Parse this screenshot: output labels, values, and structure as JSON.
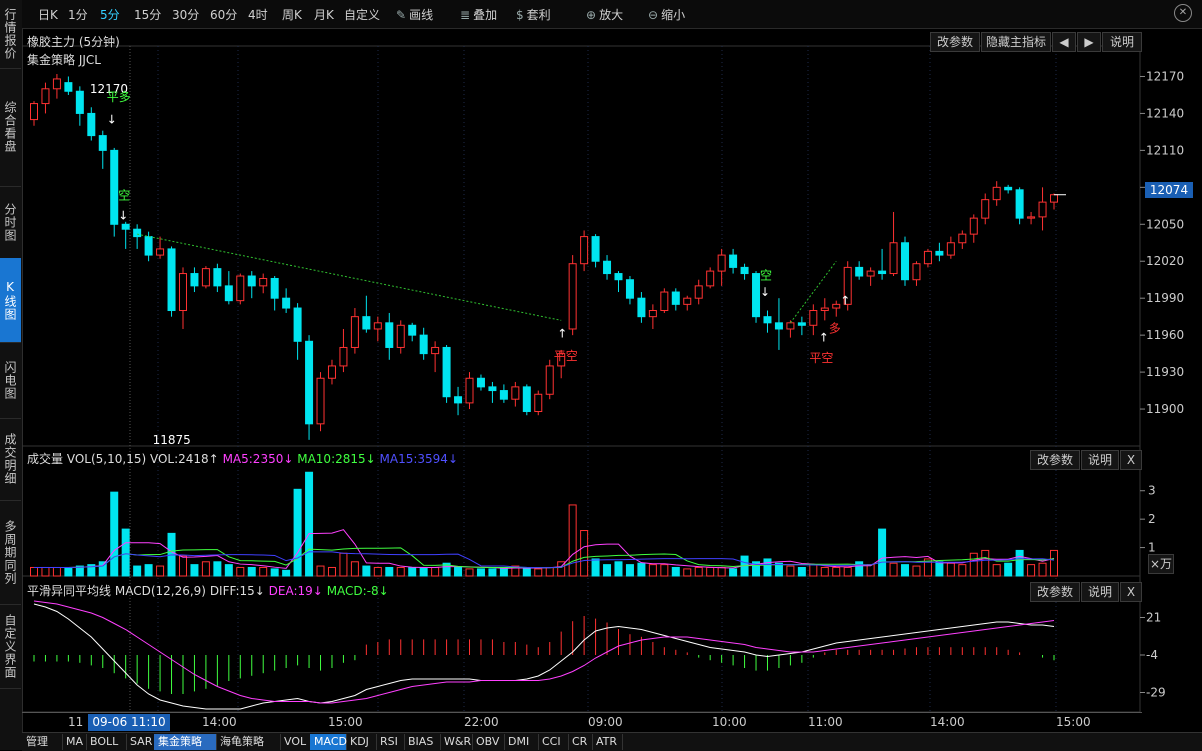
{
  "toolbar": {
    "items": [
      {
        "label": "日K",
        "active": false
      },
      {
        "label": "1分",
        "active": false
      },
      {
        "label": "5分",
        "active": true
      },
      {
        "label": "15分",
        "active": false
      },
      {
        "label": "30分",
        "active": false
      },
      {
        "label": "60分",
        "active": false
      },
      {
        "label": "4时",
        "active": false
      },
      {
        "label": "周K",
        "active": false
      },
      {
        "label": "月K",
        "active": false
      },
      {
        "label": "自定义",
        "active": false
      },
      {
        "label": "画线",
        "icon": "pencil-icon"
      },
      {
        "label": "叠加",
        "icon": "stack-icon"
      },
      {
        "label": "套利",
        "icon": "money-bag-icon"
      },
      {
        "label": "放大",
        "icon": "zoom-in-icon"
      },
      {
        "label": "缩小",
        "icon": "zoom-out-icon"
      }
    ]
  },
  "sidebar": {
    "items": [
      {
        "label": "行情报价",
        "active": false
      },
      {
        "label": "综合看盘",
        "active": false
      },
      {
        "label": "分时图",
        "active": false
      },
      {
        "label": "K线图",
        "active": true
      },
      {
        "label": "闪电图",
        "active": false
      },
      {
        "label": "成交明细",
        "active": false
      },
      {
        "label": "多周期同列",
        "active": false
      },
      {
        "label": "自定义界面",
        "active": false
      }
    ]
  },
  "main_panel": {
    "title": "橡胶主力 (5分钟)",
    "strategy": "集金策略 JJCL",
    "buttons": {
      "params": "改参数",
      "hide": "隐藏主指标",
      "prev": "◀",
      "next": "▶",
      "help": "说明"
    },
    "current_price": "12074"
  },
  "vol_panel": {
    "label": "成交量",
    "name": "VOL(5,10,15)",
    "vol": "VOL:2418↑",
    "ma5": "MA5:2350↓",
    "ma10": "MA10:2815↓",
    "ma15": "MA15:3594↓",
    "unit": "×万",
    "buttons": {
      "params": "改参数",
      "help": "说明",
      "close": "X"
    }
  },
  "macd_panel": {
    "label": "平滑异同平均线",
    "name": "MACD(12,26,9)",
    "diff": "DIFF:15↓",
    "dea": "DEA:19↓",
    "macd": "MACD:-8↓",
    "buttons": {
      "params": "改参数",
      "help": "说明",
      "close": "X"
    }
  },
  "time_axis": {
    "cursor_label": "09-06 11:10",
    "ticks": [
      {
        "label": "11"
      },
      {
        "label": "14:00"
      },
      {
        "label": "15:00"
      },
      {
        "label": "22:00"
      },
      {
        "label": "09:00"
      },
      {
        "label": "10:00"
      },
      {
        "label": "11:00"
      },
      {
        "label": "14:00"
      },
      {
        "label": "15:00"
      }
    ]
  },
  "bottom_tabs": [
    "管理",
    "MA",
    "BOLL",
    "SAR",
    "集金策略",
    "海龟策略",
    "VOL",
    "MACD",
    "KDJ",
    "RSI",
    "BIAS",
    "W&R",
    "OBV",
    "DMI",
    "CCI",
    "CR",
    "ATR"
  ],
  "colors": {
    "up": "#ff3232",
    "down": "#00e5f0",
    "ma5": "#ff40ff",
    "ma10": "#40ff40",
    "ma15": "#4040ff",
    "diff": "#ffffff",
    "dea": "#ff40ff",
    "accent": "#1976d2"
  },
  "chart_data": {
    "type": "candlestick",
    "price_ticks": [
      "12170",
      "12140",
      "12110",
      "12080",
      "12050",
      "12020",
      "11990",
      "11960",
      "11930",
      "11900"
    ],
    "candles": [
      {
        "o": 12135,
        "h": 12150,
        "l": 12130,
        "c": 12148
      },
      {
        "o": 12148,
        "h": 12165,
        "l": 12140,
        "c": 12160
      },
      {
        "o": 12160,
        "h": 12172,
        "l": 12152,
        "c": 12168
      },
      {
        "o": 12165,
        "h": 12170,
        "l": 12155,
        "c": 12158
      },
      {
        "o": 12158,
        "h": 12162,
        "l": 12130,
        "c": 12140
      },
      {
        "o": 12140,
        "h": 12145,
        "l": 12118,
        "c": 12122
      },
      {
        "o": 12122,
        "h": 12126,
        "l": 12095,
        "c": 12110
      },
      {
        "o": 12110,
        "h": 12112,
        "l": 12040,
        "c": 12050
      },
      {
        "o": 12050,
        "h": 12052,
        "l": 12030,
        "c": 12046
      },
      {
        "o": 12046,
        "h": 12050,
        "l": 12030,
        "c": 12040
      },
      {
        "o": 12040,
        "h": 12044,
        "l": 12020,
        "c": 12025
      },
      {
        "o": 12025,
        "h": 12040,
        "l": 12022,
        "c": 12030
      },
      {
        "o": 12030,
        "h": 12032,
        "l": 11975,
        "c": 11980
      },
      {
        "o": 11980,
        "h": 12015,
        "l": 11965,
        "c": 12010
      },
      {
        "o": 12010,
        "h": 12015,
        "l": 11995,
        "c": 12000
      },
      {
        "o": 12000,
        "h": 12016,
        "l": 11998,
        "c": 12014
      },
      {
        "o": 12014,
        "h": 12018,
        "l": 11995,
        "c": 12000
      },
      {
        "o": 12000,
        "h": 12012,
        "l": 11985,
        "c": 11988
      },
      {
        "o": 11988,
        "h": 12010,
        "l": 11985,
        "c": 12008
      },
      {
        "o": 12008,
        "h": 12012,
        "l": 11990,
        "c": 12000
      },
      {
        "o": 12000,
        "h": 12010,
        "l": 11994,
        "c": 12006
      },
      {
        "o": 12006,
        "h": 12008,
        "l": 11980,
        "c": 11990
      },
      {
        "o": 11990,
        "h": 11998,
        "l": 11978,
        "c": 11982
      },
      {
        "o": 11982,
        "h": 11986,
        "l": 11940,
        "c": 11955
      },
      {
        "o": 11955,
        "h": 11960,
        "l": 11875,
        "c": 11888
      },
      {
        "o": 11888,
        "h": 11930,
        "l": 11882,
        "c": 11925
      },
      {
        "o": 11925,
        "h": 11940,
        "l": 11920,
        "c": 11935
      },
      {
        "o": 11935,
        "h": 11965,
        "l": 11930,
        "c": 11950
      },
      {
        "o": 11950,
        "h": 11982,
        "l": 11945,
        "c": 11975
      },
      {
        "o": 11975,
        "h": 11992,
        "l": 11962,
        "c": 11965
      },
      {
        "o": 11965,
        "h": 11975,
        "l": 11955,
        "c": 11970
      },
      {
        "o": 11970,
        "h": 11978,
        "l": 11940,
        "c": 11950
      },
      {
        "o": 11950,
        "h": 11972,
        "l": 11945,
        "c": 11968
      },
      {
        "o": 11968,
        "h": 11970,
        "l": 11955,
        "c": 11960
      },
      {
        "o": 11960,
        "h": 11966,
        "l": 11940,
        "c": 11945
      },
      {
        "o": 11945,
        "h": 11955,
        "l": 11930,
        "c": 11950
      },
      {
        "o": 11950,
        "h": 11952,
        "l": 11905,
        "c": 11910
      },
      {
        "o": 11910,
        "h": 11918,
        "l": 11895,
        "c": 11905
      },
      {
        "o": 11905,
        "h": 11930,
        "l": 11900,
        "c": 11925
      },
      {
        "o": 11925,
        "h": 11928,
        "l": 11915,
        "c": 11918
      },
      {
        "o": 11918,
        "h": 11922,
        "l": 11905,
        "c": 11915
      },
      {
        "o": 11915,
        "h": 11920,
        "l": 11905,
        "c": 11908
      },
      {
        "o": 11908,
        "h": 11922,
        "l": 11902,
        "c": 11918
      },
      {
        "o": 11918,
        "h": 11920,
        "l": 11895,
        "c": 11898
      },
      {
        "o": 11898,
        "h": 11915,
        "l": 11895,
        "c": 11912
      },
      {
        "o": 11912,
        "h": 11940,
        "l": 11908,
        "c": 11935
      },
      {
        "o": 11935,
        "h": 11948,
        "l": 11925,
        "c": 11945
      },
      {
        "o": 11965,
        "h": 12025,
        "l": 11960,
        "c": 12018
      },
      {
        "o": 12018,
        "h": 12045,
        "l": 12012,
        "c": 12040
      },
      {
        "o": 12040,
        "h": 12042,
        "l": 12015,
        "c": 12020
      },
      {
        "o": 12020,
        "h": 12025,
        "l": 12005,
        "c": 12010
      },
      {
        "o": 12010,
        "h": 12012,
        "l": 11995,
        "c": 12005
      },
      {
        "o": 12005,
        "h": 12008,
        "l": 11985,
        "c": 11990
      },
      {
        "o": 11990,
        "h": 11995,
        "l": 11970,
        "c": 11975
      },
      {
        "o": 11975,
        "h": 11985,
        "l": 11965,
        "c": 11980
      },
      {
        "o": 11980,
        "h": 11998,
        "l": 11978,
        "c": 11995
      },
      {
        "o": 11995,
        "h": 11998,
        "l": 11980,
        "c": 11985
      },
      {
        "o": 11985,
        "h": 11992,
        "l": 11980,
        "c": 11990
      },
      {
        "o": 11990,
        "h": 12005,
        "l": 11985,
        "c": 12000
      },
      {
        "o": 12000,
        "h": 12015,
        "l": 11998,
        "c": 12012
      },
      {
        "o": 12012,
        "h": 12030,
        "l": 12000,
        "c": 12025
      },
      {
        "o": 12025,
        "h": 12030,
        "l": 12010,
        "c": 12015
      },
      {
        "o": 12015,
        "h": 12018,
        "l": 12005,
        "c": 12010
      },
      {
        "o": 12010,
        "h": 12012,
        "l": 11970,
        "c": 11975
      },
      {
        "o": 11975,
        "h": 11980,
        "l": 11962,
        "c": 11970
      },
      {
        "o": 11970,
        "h": 11990,
        "l": 11948,
        "c": 11965
      },
      {
        "o": 11965,
        "h": 11972,
        "l": 11958,
        "c": 11970
      },
      {
        "o": 11970,
        "h": 11975,
        "l": 11960,
        "c": 11968
      },
      {
        "o": 11968,
        "h": 11985,
        "l": 11960,
        "c": 11980
      },
      {
        "o": 11980,
        "h": 11990,
        "l": 11972,
        "c": 11982
      },
      {
        "o": 11982,
        "h": 11988,
        "l": 11975,
        "c": 11985
      },
      {
        "o": 11985,
        "h": 12020,
        "l": 11980,
        "c": 12015
      },
      {
        "o": 12015,
        "h": 12020,
        "l": 12005,
        "c": 12008
      },
      {
        "o": 12008,
        "h": 12015,
        "l": 12000,
        "c": 12012
      },
      {
        "o": 12012,
        "h": 12030,
        "l": 12005,
        "c": 12010
      },
      {
        "o": 12010,
        "h": 12060,
        "l": 12008,
        "c": 12035
      },
      {
        "o": 12035,
        "h": 12040,
        "l": 12000,
        "c": 12005
      },
      {
        "o": 12005,
        "h": 12020,
        "l": 12000,
        "c": 12018
      },
      {
        "o": 12018,
        "h": 12030,
        "l": 12015,
        "c": 12028
      },
      {
        "o": 12028,
        "h": 12035,
        "l": 12020,
        "c": 12025
      },
      {
        "o": 12025,
        "h": 12040,
        "l": 12022,
        "c": 12035
      },
      {
        "o": 12035,
        "h": 12045,
        "l": 12030,
        "c": 12042
      },
      {
        "o": 12042,
        "h": 12058,
        "l": 12035,
        "c": 12055
      },
      {
        "o": 12055,
        "h": 12075,
        "l": 12050,
        "c": 12070
      },
      {
        "o": 12070,
        "h": 12085,
        "l": 12065,
        "c": 12080
      },
      {
        "o": 12080,
        "h": 12082,
        "l": 12075,
        "c": 12078
      },
      {
        "o": 12078,
        "h": 12080,
        "l": 12050,
        "c": 12055
      },
      {
        "o": 12055,
        "h": 12060,
        "l": 12050,
        "c": 12056
      },
      {
        "o": 12056,
        "h": 12080,
        "l": 12045,
        "c": 12068
      },
      {
        "o": 12068,
        "h": 12075,
        "l": 12062,
        "c": 12074
      }
    ],
    "annotations": [
      {
        "text": "12170",
        "color": "#ffffff"
      },
      {
        "text": "11875",
        "color": "#ffffff"
      },
      {
        "text": "平多",
        "color": "#40ff40"
      },
      {
        "text": "空",
        "color": "#40ff40"
      },
      {
        "text": "平空",
        "color": "#ff3232"
      },
      {
        "text": "空",
        "color": "#40ff40"
      },
      {
        "text": "多",
        "color": "#ff3232"
      },
      {
        "text": "平空",
        "color": "#ff3232"
      }
    ],
    "volume_ticks": [
      "3",
      "2",
      "1"
    ],
    "volume": [
      0.3,
      0.3,
      0.3,
      0.3,
      0.35,
      0.4,
      0.5,
      2.95,
      1.65,
      0.35,
      0.4,
      0.35,
      1.5,
      0.7,
      0.4,
      0.5,
      0.5,
      0.4,
      0.3,
      0.3,
      0.3,
      0.25,
      0.2,
      3.05,
      3.65,
      0.35,
      0.3,
      0.8,
      0.5,
      0.35,
      0.3,
      0.3,
      0.3,
      0.3,
      0.3,
      0.3,
      0.45,
      0.3,
      0.25,
      0.25,
      0.25,
      0.3,
      0.35,
      0.25,
      0.25,
      0.3,
      0.5,
      2.5,
      1.6,
      0.6,
      0.4,
      0.5,
      0.4,
      0.45,
      0.4,
      0.4,
      0.3,
      0.25,
      0.3,
      0.3,
      0.3,
      0.25,
      0.7,
      0.5,
      0.6,
      0.45,
      0.35,
      0.3,
      0.4,
      0.3,
      0.3,
      0.3,
      0.5,
      0.4,
      1.65,
      0.45,
      0.4,
      0.35,
      0.6,
      0.5,
      0.45,
      0.4,
      0.8,
      0.9,
      0.4,
      0.45,
      0.9,
      0.4,
      0.45,
      0.9
    ],
    "macd_ticks": [
      "21",
      "-4",
      "-29"
    ],
    "macd_hist": [
      -5,
      -5,
      -5,
      -5,
      -6,
      -8,
      -10,
      -14,
      -18,
      -22,
      -26,
      -28,
      -30,
      -30,
      -28,
      -26,
      -24,
      -20,
      -18,
      -16,
      -14,
      -12,
      -10,
      -8,
      -10,
      -12,
      -10,
      -6,
      -4,
      8,
      10,
      12,
      12,
      12,
      12,
      12,
      12,
      12,
      12,
      12,
      12,
      10,
      10,
      8,
      6,
      10,
      18,
      26,
      30,
      28,
      25,
      20,
      16,
      14,
      10,
      6,
      4,
      2,
      -2,
      -4,
      -6,
      -8,
      -10,
      -12,
      -12,
      -10,
      -8,
      -6,
      -2,
      2,
      4,
      4,
      4,
      4,
      4,
      4,
      5,
      6,
      6,
      6,
      6,
      6,
      6,
      6,
      6,
      4,
      2,
      0,
      -2,
      -4
    ],
    "diff": [
      30,
      28,
      25,
      20,
      14,
      8,
      0,
      -8,
      -16,
      -24,
      -30,
      -34,
      -36,
      -38,
      -39,
      -40,
      -40,
      -40,
      -40,
      -38,
      -36,
      -35,
      -34,
      -33,
      -35,
      -36,
      -35,
      -33,
      -31,
      -27,
      -25,
      -23,
      -21,
      -20,
      -20,
      -20,
      -20,
      -20,
      -20,
      -21,
      -21,
      -21,
      -21,
      -20,
      -18,
      -14,
      -8,
      -2,
      6,
      12,
      14,
      15,
      14,
      13,
      11,
      9,
      7,
      5,
      3,
      1,
      0,
      -1,
      -2,
      -4,
      -5,
      -4,
      -3,
      -2,
      0,
      2,
      4,
      5,
      6,
      7,
      8,
      9,
      10,
      11,
      12,
      13,
      14,
      15,
      16,
      17,
      18,
      18,
      17,
      16,
      16,
      15
    ],
    "dea": [
      32,
      31,
      30,
      28,
      26,
      24,
      21,
      17,
      13,
      8,
      3,
      -2,
      -7,
      -12,
      -17,
      -21,
      -25,
      -28,
      -31,
      -33,
      -34,
      -35,
      -35,
      -35,
      -35,
      -36,
      -36,
      -35,
      -34,
      -33,
      -31,
      -29,
      -27,
      -25,
      -24,
      -23,
      -22,
      -22,
      -22,
      -21,
      -21,
      -21,
      -21,
      -21,
      -21,
      -20,
      -18,
      -15,
      -11,
      -6,
      -2,
      2,
      4,
      6,
      7,
      8,
      8,
      8,
      7,
      6,
      5,
      4,
      3,
      1,
      0,
      -1,
      -2,
      -2,
      -2,
      -1,
      0,
      1,
      2,
      3,
      4,
      5,
      6,
      7,
      8,
      9,
      10,
      11,
      12,
      13,
      14,
      15,
      16,
      17,
      18,
      19
    ]
  }
}
